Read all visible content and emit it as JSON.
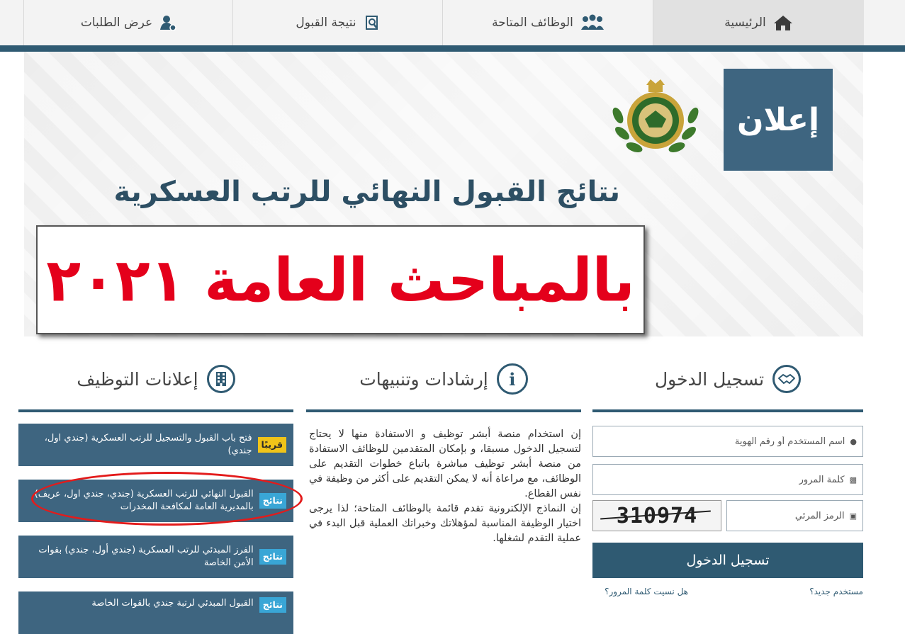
{
  "nav": {
    "home": "الرئيسية",
    "jobs": "الوظائف المتاحة",
    "result": "نتيجة القبول",
    "applications": "عرض الطلبات"
  },
  "banner": {
    "announce": "إعلان",
    "title": "نتائج القبول النهائي للرتب العسكرية",
    "overlay": "بالمباحث العامة ٢٠٢١"
  },
  "sections": {
    "login": "تسجيل الدخول",
    "guidelines": "إرشادات وتنبيهات",
    "jobs": "إعلانات التوظيف"
  },
  "login": {
    "username_placeholder": "اسم المستخدم أو رقم الهوية",
    "password_placeholder": "كلمة المرور",
    "captcha_placeholder": "الرمز المرئي",
    "captcha_code": "310974",
    "submit": "تسجيل الدخول",
    "new_user": "مستخدم جديد؟",
    "forgot_password": "هل نسيت كلمة المرور؟"
  },
  "guidelines": {
    "p1": "إن استخدام منصة أبشر توظيف و الاستفادة منها لا يحتاج لتسجيل الدخول مسبقا، و بإمكان المتقدمين للوظائف الاستفادة من منصة أبشر توظيف مباشرة باتباع خطوات التقديم على الوظائف، مع مراعاة أنه لا يمكن التقديم على أكثر من وظيفة في نفس القطاع.",
    "p2": "إن النماذج الإلكترونية تقدم قائمة بالوظائف المتاحة؛ لذا يرجى اختيار الوظيفة المناسبة لمؤهلاتك وخبراتك العملية قبل البدء في عملية التقدم لشغلها."
  },
  "ads": [
    {
      "badge": "قريبًا",
      "text": "فتح باب القبول والتسجيل للرتب العسكرية (جندي اول، جندي)"
    },
    {
      "badge": "نتائج",
      "text": "القبول النهائي للرتب العسكرية (جندي، جندي اول، عريف) بالمديرية العامة لمكافحة المخدرات"
    },
    {
      "badge": "نتائج",
      "text": "الفرز المبدئي للرتب العسكرية (جندي أول، جندي) بقوات الأمن الخاصة"
    },
    {
      "badge": "نتائج",
      "text": "القبول المبدئي لرتبة جندي بالقوات الخاصة"
    }
  ],
  "colors": {
    "primary": "#2f5a72",
    "ad_bg": "#3e6580",
    "badge_soon": "#f0c419",
    "badge_result": "#39a6d6",
    "overlay_text": "#e4001b"
  }
}
